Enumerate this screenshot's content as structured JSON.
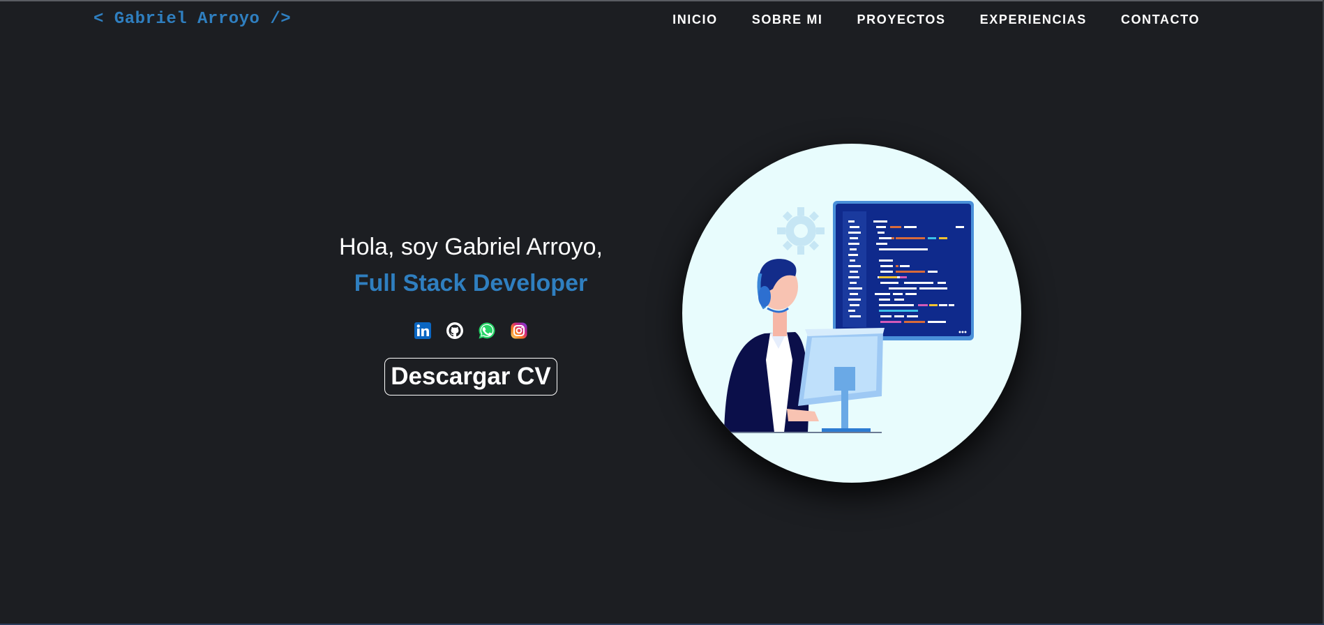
{
  "header": {
    "brand": "< Gabriel Arroyo />",
    "nav": [
      "INICIO",
      "SOBRE MI",
      "PROYECTOS",
      "EXPERIENCIAS",
      "CONTACTO"
    ]
  },
  "hero": {
    "greeting": "Hola, soy Gabriel Arroyo,",
    "role": "Full Stack Developer",
    "socials": [
      "linkedin-icon",
      "github-icon",
      "whatsapp-icon",
      "instagram-icon"
    ],
    "cv_button": "Descargar CV"
  },
  "colors": {
    "background": "#1c1e22",
    "accent": "#2f7fc0",
    "illustration_bg": "#e8fcfd"
  }
}
